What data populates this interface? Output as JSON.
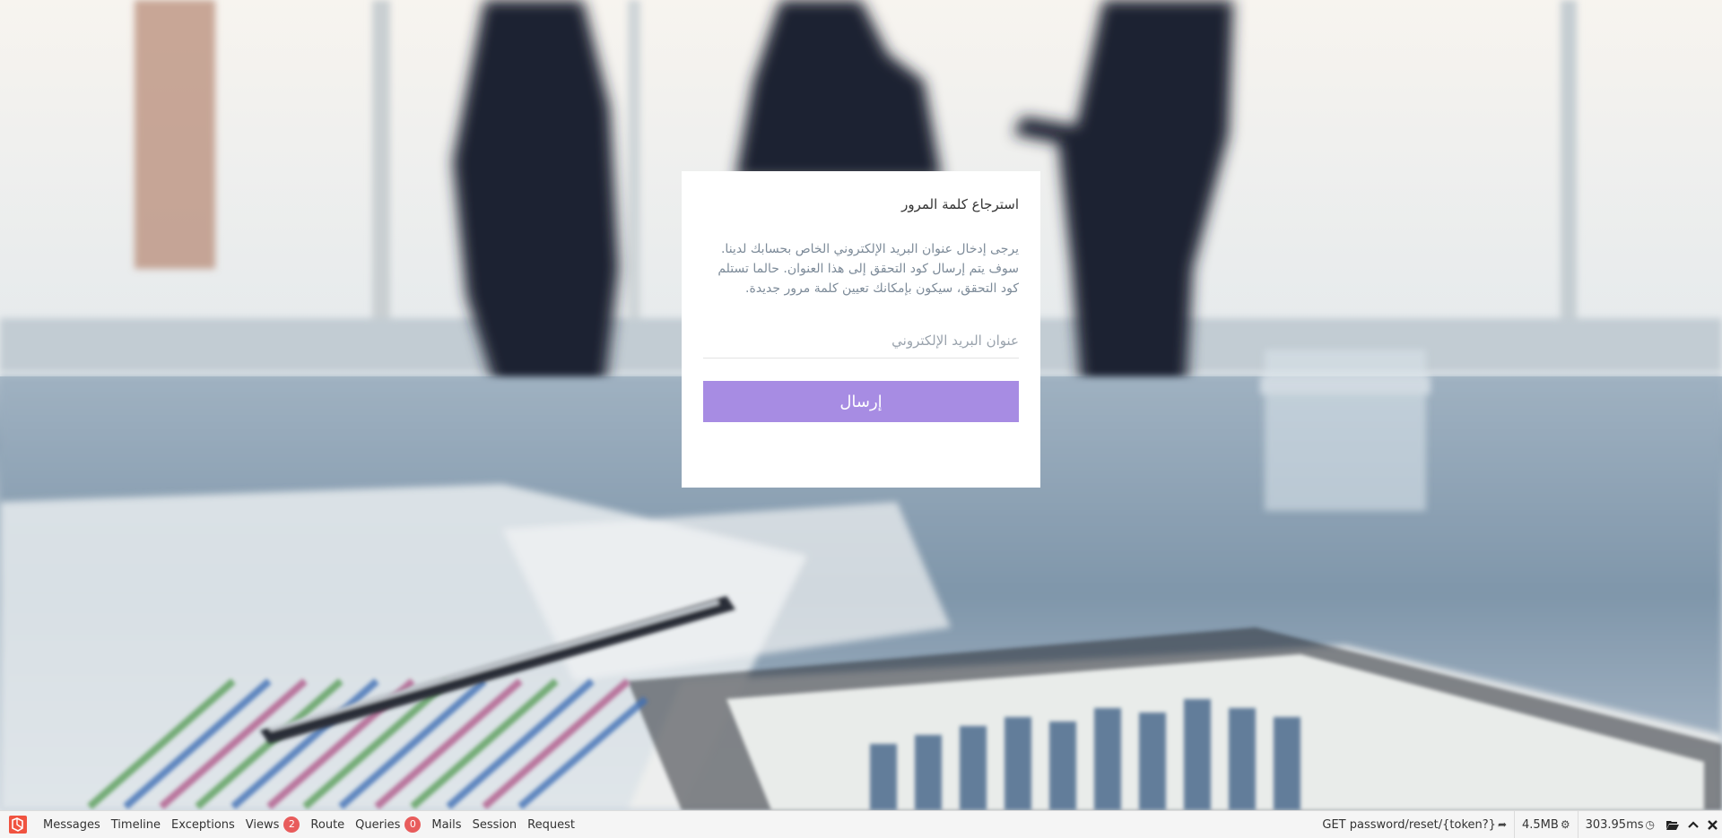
{
  "background": {
    "description_icon": "office-meeting-photo"
  },
  "card": {
    "title": "استرجاع كلمة المرور",
    "description": "يرجى إدخال عنوان البريد الإلكتروني الخاص بحسابك لدينا. سوف يتم إرسال كود التحقق إلى هذا العنوان. حالما تستلم كود التحقق، سيكون بإمكانك تعيين كلمة مرور جديدة.",
    "email_placeholder": "عنوان البريد الإلكتروني",
    "email_value": "",
    "submit_label": "إرسال",
    "accent_color": "#a78ce3"
  },
  "debugbar": {
    "logo_icon": "laravel-logo-icon",
    "tabs": [
      {
        "label": "Messages"
      },
      {
        "label": "Timeline"
      },
      {
        "label": "Exceptions"
      },
      {
        "label": "Views",
        "badge": "2"
      },
      {
        "label": "Route"
      },
      {
        "label": "Queries",
        "badge": "0"
      },
      {
        "label": "Mails"
      },
      {
        "label": "Session"
      },
      {
        "label": "Request"
      }
    ],
    "route": "GET password/reset/{token?}",
    "route_icon": "share-icon",
    "memory": "4.5MB",
    "memory_icon": "cogs-icon",
    "time": "303.95ms",
    "time_icon": "clock-icon",
    "controls": [
      {
        "icon": "folder-open-icon"
      },
      {
        "icon": "chevron-up-icon"
      },
      {
        "icon": "close-icon"
      }
    ],
    "badge_color": "#e85c5c"
  }
}
